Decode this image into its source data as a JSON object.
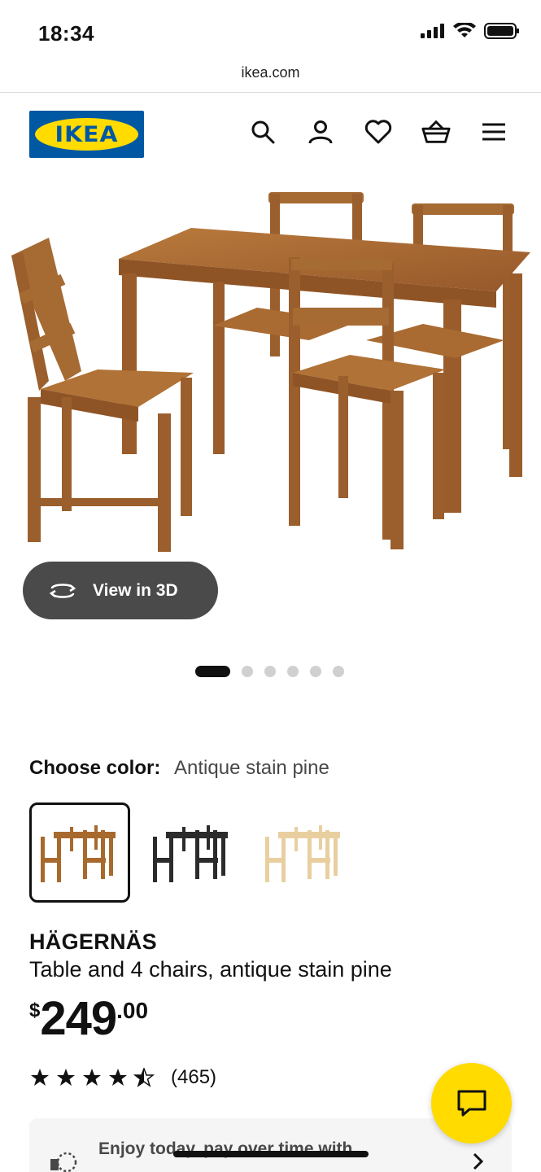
{
  "status_bar": {
    "time": "18:34"
  },
  "browser": {
    "url": "ikea.com"
  },
  "header": {
    "logo_text": "IKEA",
    "icons": [
      "search-icon",
      "account-icon",
      "heart-icon",
      "basket-icon",
      "menu-icon"
    ]
  },
  "hero": {
    "view3d_label": "View in 3D",
    "image_count": 6,
    "active_image": 1
  },
  "color": {
    "label": "Choose color:",
    "value": "Antique stain pine",
    "options": [
      {
        "name": "Antique stain pine",
        "swatch": "#a8692e",
        "selected": true
      },
      {
        "name": "Black",
        "swatch": "#2b2b2b",
        "selected": false
      },
      {
        "name": "Pine",
        "swatch": "#e9cf9f",
        "selected": false
      }
    ]
  },
  "product": {
    "name": "HÄGERNÄS",
    "description": "Table and 4 chairs, antique stain pine",
    "price_currency": "$",
    "price_main": "249",
    "price_decimal": ".00",
    "rating": 4.5,
    "rating_count": "(465)"
  },
  "afterpay": {
    "text": "Enjoy today, pay over time with"
  },
  "colors": {
    "brand_blue": "#0058a3",
    "brand_yellow": "#ffdb00",
    "wood": "#a8692e"
  }
}
